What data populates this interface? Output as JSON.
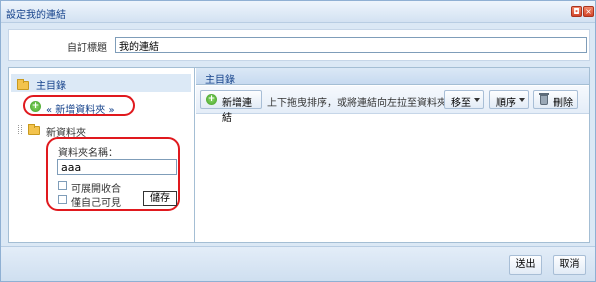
{
  "window": {
    "title": "設定我的連結",
    "btn_a": "◘",
    "btn_b": "×"
  },
  "custom_title": {
    "label": "自訂標題",
    "value": "我的連結"
  },
  "tree": {
    "root_label": "主目錄",
    "add_folder_text": "« 新增資料夾 »",
    "new_folder_label": "新資料夾",
    "form": {
      "name_label": "資料夾名稱：",
      "name_value": "aaa",
      "option_collapsible": "可展開收合",
      "option_self_only": "僅自己可見",
      "save_label": "儲存"
    }
  },
  "right_pane": {
    "header": "主目錄",
    "add_link_label": "新增連結",
    "hint": "上下拖曳排序，或將連結向左拉至資料夾",
    "move_label": "移至",
    "order_label": "順序",
    "delete_label": "刪除"
  },
  "footer": {
    "submit_label": "送出",
    "cancel_label": "取消"
  },
  "colors": {
    "accent": "#15428b",
    "highlight": "#e0191e",
    "panel_bg": "#dbe8f5"
  }
}
